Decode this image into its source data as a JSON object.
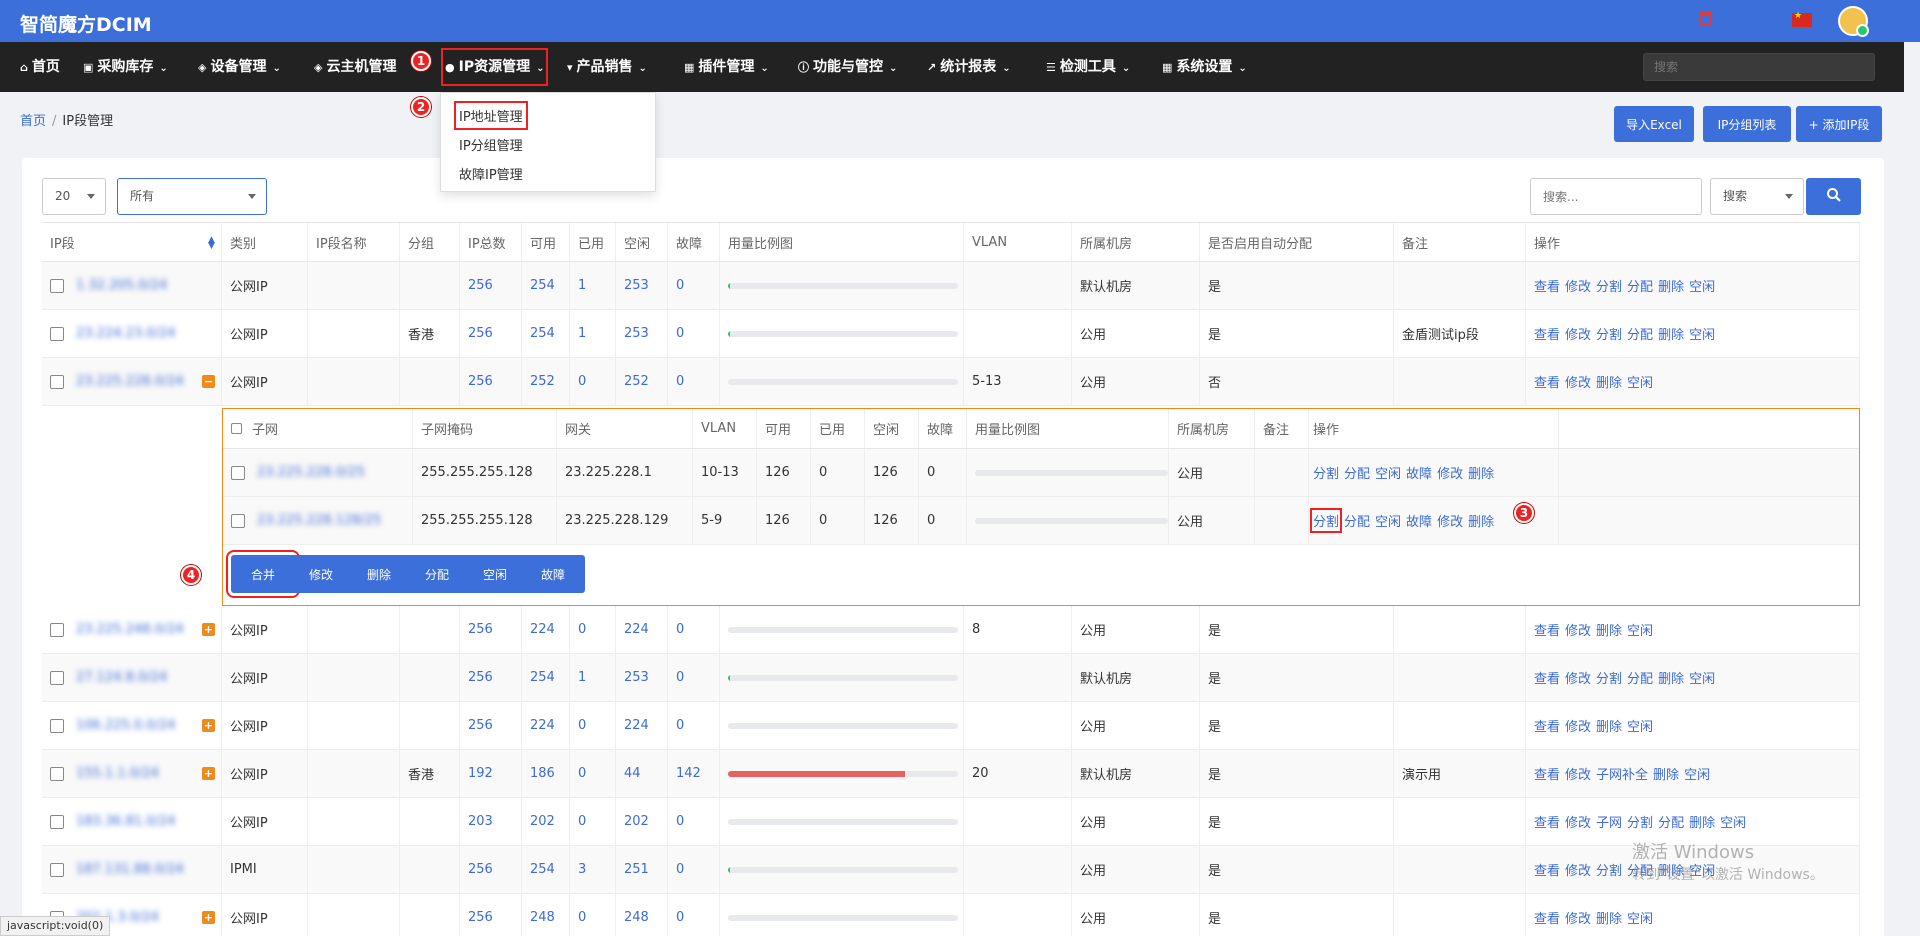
{
  "app": {
    "title": "智简魔方DCIM"
  },
  "colors": {
    "primary": "#3c6fd9",
    "navbar": "#222222",
    "highlight": "#e22222",
    "expand": "#f08a1a",
    "bar_high": "#e96060"
  },
  "nav": {
    "items": [
      {
        "label": "首页",
        "icon": "home-icon"
      },
      {
        "label": "采购库存",
        "icon": "truck-icon"
      },
      {
        "label": "设备管理",
        "icon": "cube-icon"
      },
      {
        "label": "云主机管理",
        "icon": "cube-icon"
      },
      {
        "label": "IP资源管理",
        "icon": "map-marker-icon"
      },
      {
        "label": "产品销售",
        "icon": "cart-icon"
      },
      {
        "label": "插件管理",
        "icon": "grid-icon"
      },
      {
        "label": "功能与管控",
        "icon": "info-icon"
      },
      {
        "label": "统计报表",
        "icon": "chart-icon"
      },
      {
        "label": "检测工具",
        "icon": "list-icon"
      },
      {
        "label": "系统设置",
        "icon": "grid-icon"
      }
    ],
    "search_placeholder": "搜索"
  },
  "dropdown": {
    "items": [
      "IP地址管理",
      "IP分组管理",
      "故障IP管理"
    ]
  },
  "steps": [
    "1",
    "2",
    "3",
    "4"
  ],
  "breadcrumb": {
    "home": "首页",
    "current": "IP段管理"
  },
  "top_buttons": {
    "import": "导入Excel",
    "groups": "IP分组列表",
    "add": "+ 添加IP段"
  },
  "filters": {
    "page_size": "20",
    "category": "所有",
    "search_placeholder": "搜索...",
    "search_field": "搜索"
  },
  "table": {
    "headers": [
      "IP段",
      "类别",
      "IP段名称",
      "分组",
      "IP总数",
      "可用",
      "已用",
      "空闲",
      "故障",
      "用量比例图",
      "VLAN",
      "所属机房",
      "是否启用自动分配",
      "备注",
      "操作"
    ],
    "rows": [
      {
        "ip": "1.32.205.0/24",
        "cat": "公网IP",
        "name": "",
        "group": "",
        "total": "256",
        "avail": "254",
        "used": "1",
        "free": "253",
        "fault": "0",
        "usage": 0.01,
        "vlan": "",
        "room": "默认机房",
        "auto": "是",
        "note": "",
        "ops": [
          "查看",
          "修改",
          "分割",
          "分配",
          "删除",
          "空闲"
        ],
        "toggle": ""
      },
      {
        "ip": "23.224.23.0/24",
        "cat": "公网IP",
        "name": "",
        "group": "香港",
        "total": "256",
        "avail": "254",
        "used": "1",
        "free": "253",
        "fault": "0",
        "usage": 0.01,
        "vlan": "",
        "room": "公用",
        "auto": "是",
        "note": "金盾测试ip段",
        "ops": [
          "查看",
          "修改",
          "分割",
          "分配",
          "删除",
          "空闲"
        ],
        "toggle": ""
      },
      {
        "ip": "23.225.228.0/24",
        "cat": "公网IP",
        "name": "",
        "group": "",
        "total": "256",
        "avail": "252",
        "used": "0",
        "free": "252",
        "fault": "0",
        "usage": 0,
        "vlan": "5-13",
        "room": "公用",
        "auto": "否",
        "note": "",
        "ops": [
          "查看",
          "修改",
          "删除",
          "空闲"
        ],
        "toggle": "−"
      },
      {
        "ip": "23.225.248.0/24",
        "cat": "公网IP",
        "name": "",
        "group": "",
        "total": "256",
        "avail": "224",
        "used": "0",
        "free": "224",
        "fault": "0",
        "usage": 0,
        "vlan": "8",
        "room": "公用",
        "auto": "是",
        "note": "",
        "ops": [
          "查看",
          "修改",
          "删除",
          "空闲"
        ],
        "toggle": "+"
      },
      {
        "ip": "27.124.8.0/24",
        "cat": "公网IP",
        "name": "",
        "group": "",
        "total": "256",
        "avail": "254",
        "used": "1",
        "free": "253",
        "fault": "0",
        "usage": 0.01,
        "vlan": "",
        "room": "默认机房",
        "auto": "是",
        "note": "",
        "ops": [
          "查看",
          "修改",
          "分割",
          "分配",
          "删除",
          "空闲"
        ],
        "toggle": ""
      },
      {
        "ip": "106.225.0.0/24",
        "cat": "公网IP",
        "name": "",
        "group": "",
        "total": "256",
        "avail": "224",
        "used": "0",
        "free": "224",
        "fault": "0",
        "usage": 0,
        "vlan": "",
        "room": "公用",
        "auto": "是",
        "note": "",
        "ops": [
          "查看",
          "修改",
          "删除",
          "空闲"
        ],
        "toggle": "+"
      },
      {
        "ip": "155.1.1.0/24",
        "cat": "公网IP",
        "name": "",
        "group": "香港",
        "total": "192",
        "avail": "186",
        "used": "0",
        "free": "44",
        "fault": "142",
        "usage": 0.77,
        "vlan": "20",
        "room": "默认机房",
        "auto": "是",
        "note": "演示用",
        "ops": [
          "查看",
          "修改",
          "子网补全",
          "删除",
          "空闲"
        ],
        "toggle": "+"
      },
      {
        "ip": "183.36.81.0/24",
        "cat": "公网IP",
        "name": "",
        "group": "",
        "total": "203",
        "avail": "202",
        "used": "0",
        "free": "202",
        "fault": "0",
        "usage": 0,
        "vlan": "",
        "room": "公用",
        "auto": "是",
        "note": "",
        "ops": [
          "查看",
          "修改",
          "子网",
          "分割",
          "分配",
          "删除",
          "空闲"
        ],
        "toggle": ""
      },
      {
        "ip": "187.131.88.0/24",
        "cat": "IPMI",
        "name": "",
        "group": "",
        "total": "256",
        "avail": "254",
        "used": "3",
        "free": "251",
        "fault": "0",
        "usage": 0.01,
        "vlan": "",
        "room": "公用",
        "auto": "是",
        "note": "",
        "ops": [
          "查看",
          "修改",
          "分割",
          "分配",
          "删除",
          "空闲"
        ],
        "toggle": ""
      },
      {
        "ip": "202.1.3.0/24",
        "cat": "公网IP",
        "name": "",
        "group": "",
        "total": "256",
        "avail": "248",
        "used": "0",
        "free": "248",
        "fault": "0",
        "usage": 0,
        "vlan": "",
        "room": "公用",
        "auto": "是",
        "note": "",
        "ops": [
          "查看",
          "修改",
          "删除",
          "空闲"
        ],
        "toggle": "+"
      }
    ]
  },
  "subtable": {
    "headers": [
      "子网",
      "子网掩码",
      "网关",
      "VLAN",
      "可用",
      "已用",
      "空闲",
      "故障",
      "用量比例图",
      "所属机房",
      "备注",
      "操作"
    ],
    "rows": [
      {
        "subnet": "23.225.228.0/25",
        "mask": "255.255.255.128",
        "gateway": "23.225.228.1",
        "vlan": "10-13",
        "avail": "126",
        "used": "0",
        "free": "126",
        "fault": "0",
        "usage": 0,
        "room": "公用",
        "note": "",
        "ops": [
          "分割",
          "分配",
          "空闲",
          "故障",
          "修改",
          "删除"
        ]
      },
      {
        "subnet": "23.225.228.128/25",
        "mask": "255.255.255.128",
        "gateway": "23.225.228.129",
        "vlan": "5-9",
        "avail": "126",
        "used": "0",
        "free": "126",
        "fault": "0",
        "usage": 0,
        "room": "公用",
        "note": "",
        "ops": [
          "分割",
          "分配",
          "空闲",
          "故障",
          "修改",
          "删除"
        ]
      }
    ],
    "buttons": [
      "合并",
      "修改",
      "删除",
      "分配",
      "空闲",
      "故障"
    ]
  },
  "watermark": {
    "line1": "激活 Windows",
    "line2": "转到\"设置\"以激活 Windows。"
  },
  "statusbar": "javascript:void(0)"
}
